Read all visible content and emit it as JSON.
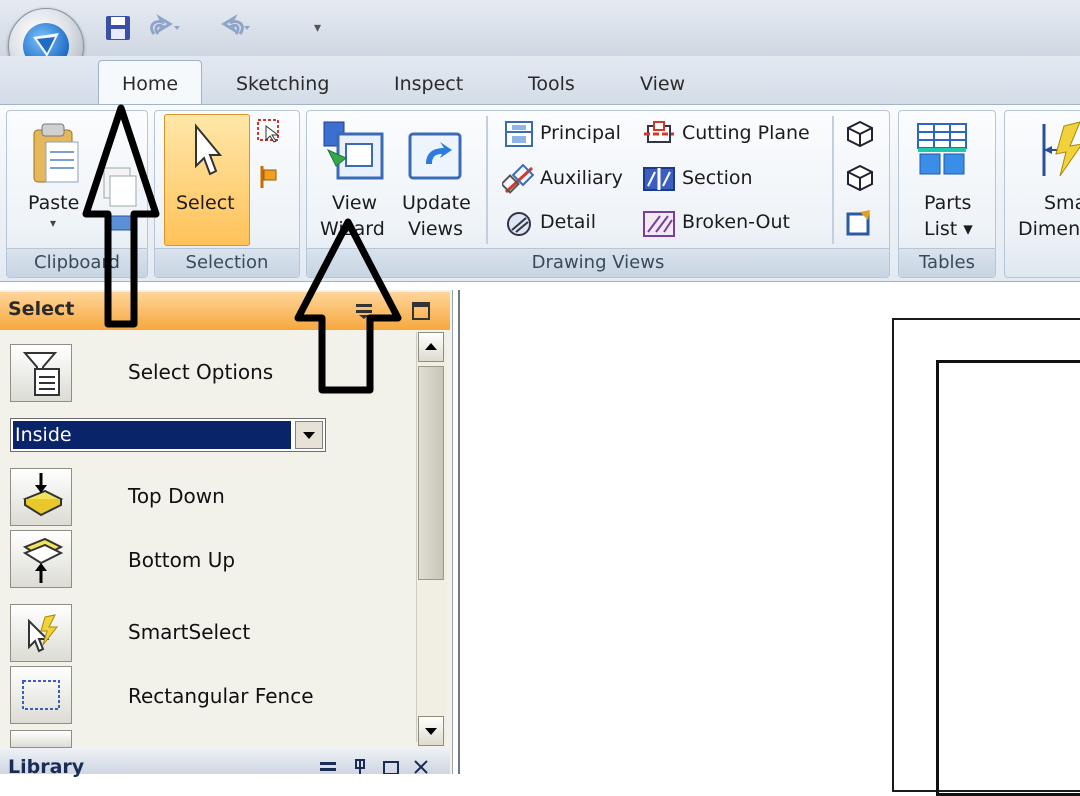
{
  "tabs": [
    "Home",
    "Sketching",
    "Inspect",
    "Tools",
    "View"
  ],
  "ribbon": {
    "clipboard": {
      "paste": "Paste",
      "group": "Clipboard"
    },
    "selection": {
      "select": "Select",
      "group": "Selection"
    },
    "drawing_views": {
      "view_wizard": [
        "View",
        "Wizard"
      ],
      "update_views": [
        "Update",
        "Views"
      ],
      "principal": "Principal",
      "auxiliary": "Auxiliary",
      "detail": "Detail",
      "cutting_plane": "Cutting Plane",
      "section": "Section",
      "broken_out": "Broken-Out",
      "group": "Drawing Views"
    },
    "tables": {
      "parts_list": [
        "Parts",
        "List ▾"
      ],
      "group": "Tables"
    },
    "smart_dimension": [
      "Sma",
      "Dimen"
    ]
  },
  "pane": {
    "title": "Select",
    "select_options": "Select Options",
    "mode_value": "Inside",
    "top_down": "Top Down",
    "bottom_up": "Bottom Up",
    "smart_select": "SmartSelect",
    "rect_fence": "Rectangular Fence"
  },
  "library_pane": {
    "title": "Library"
  },
  "colors": {
    "pane_header": "#f6a83d",
    "selection_highlight": "#0a246a",
    "select_button": "#ffc25a"
  }
}
